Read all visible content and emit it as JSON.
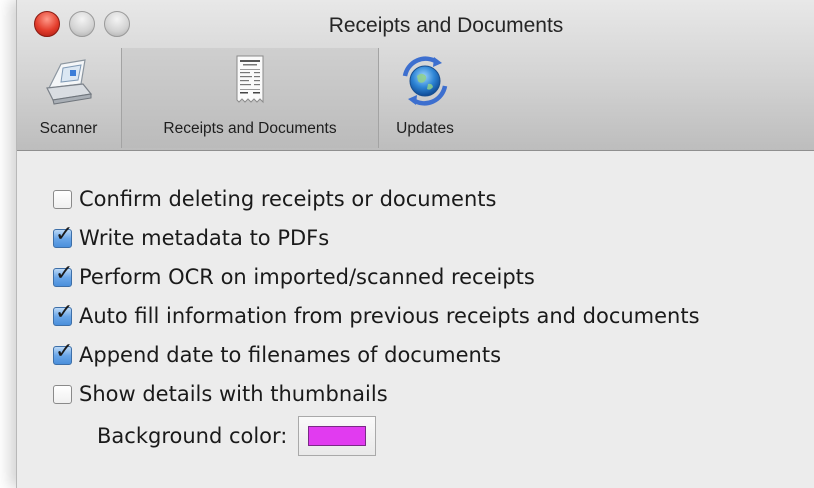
{
  "window": {
    "title": "Receipts and Documents"
  },
  "toolbar": {
    "items": [
      {
        "label": "Scanner",
        "icon": "scanner-icon"
      },
      {
        "label": "Receipts and Documents",
        "icon": "receipt-icon",
        "selected": true
      },
      {
        "label": "Updates",
        "icon": "updates-globe-icon"
      }
    ]
  },
  "options": [
    {
      "label": "Confirm deleting receipts or documents",
      "checked": false
    },
    {
      "label": "Write metadata to PDFs",
      "checked": true
    },
    {
      "label": "Perform OCR on imported/scanned receipts",
      "checked": true
    },
    {
      "label": "Auto fill information from previous receipts and documents",
      "checked": true
    },
    {
      "label": "Append date to filenames of documents",
      "checked": true
    },
    {
      "label": "Show details with thumbnails",
      "checked": false
    }
  ],
  "background": {
    "label": "Background color:",
    "color": "#e13bf0"
  }
}
